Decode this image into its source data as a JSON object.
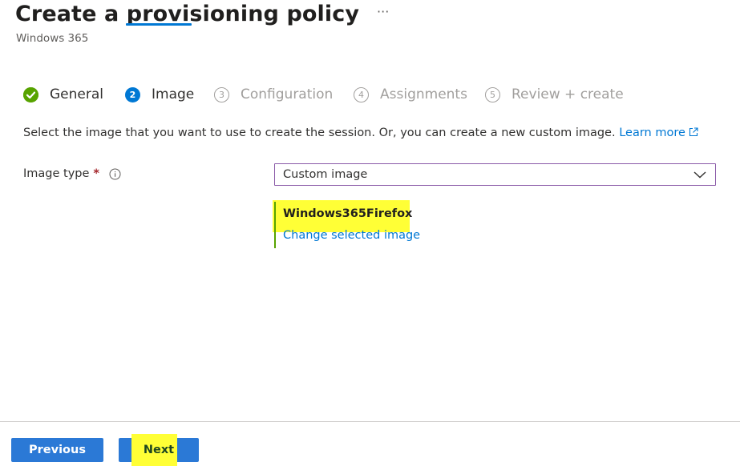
{
  "header": {
    "title": "Create a provisioning policy",
    "more_label": "···",
    "subtitle": "Windows 365"
  },
  "steps": [
    {
      "number": "",
      "label": "General",
      "state": "done"
    },
    {
      "number": "2",
      "label": "Image",
      "state": "active"
    },
    {
      "number": "3",
      "label": "Configuration",
      "state": "pending"
    },
    {
      "number": "4",
      "label": "Assignments",
      "state": "pending"
    },
    {
      "number": "5",
      "label": "Review + create",
      "state": "pending"
    }
  ],
  "intro": {
    "text": "Select the image that you want to use to create the session. Or, you can create a new custom image.",
    "link": "Learn more"
  },
  "image_type": {
    "label": "Image type",
    "required_mark": "*",
    "selected": "Custom image"
  },
  "selected_image": {
    "name": "Windows365Firefox",
    "change_link": "Change selected image"
  },
  "footer": {
    "previous_label": "Previous",
    "next_label": "Next"
  },
  "colors": {
    "accent": "#0078d4",
    "success": "#57a300",
    "highlight": "#ffff36",
    "button": "#2b79d6",
    "dropdown_border": "#8a5aa8"
  }
}
